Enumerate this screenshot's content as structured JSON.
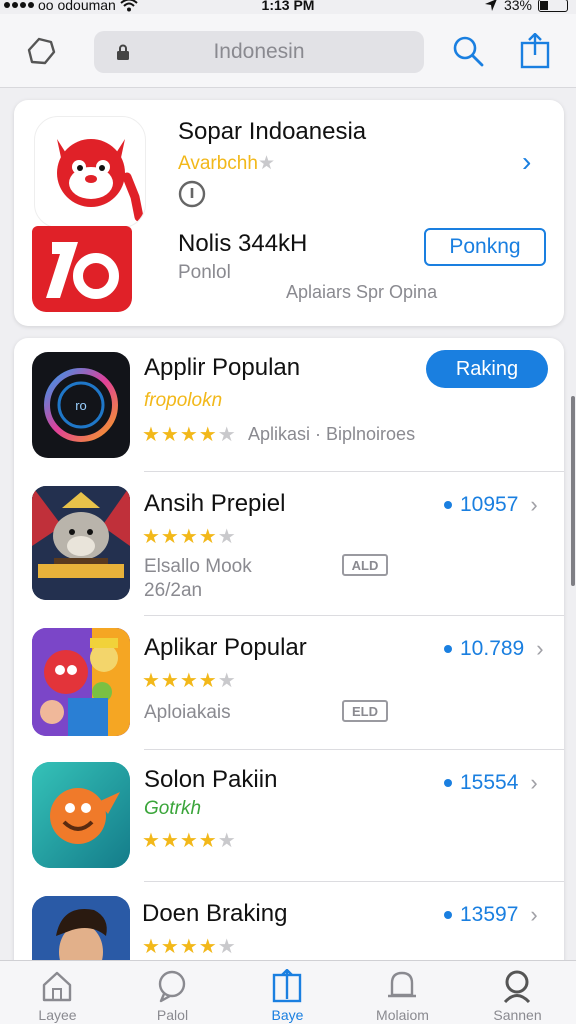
{
  "status_bar": {
    "carrier": "oo odouman",
    "time": "1:13 PM",
    "battery": "33%"
  },
  "nav": {
    "search_text": "Indonesin"
  },
  "featured": {
    "title": "Sopar Indoanesia",
    "subtitle": "Avarbchh",
    "size_text": "Nolis 344kH",
    "category": "Ponlol",
    "caption": "Aplaiars Spr Opina",
    "button_label": "Ponkng"
  },
  "list": {
    "header": {
      "title": "Applir Populan",
      "subtitle": "fropolokn",
      "rating": 4,
      "meta": "Aplikasi · Biplnoiroes",
      "button_label": "Raking"
    },
    "items": [
      {
        "title": "Ansih Prepiel",
        "rating": 4,
        "line1": "Elsallo Mook",
        "line2": "26/2an",
        "badge": "ALD",
        "count": "10957"
      },
      {
        "title": "Aplikar Popular",
        "rating": 4,
        "line1": "Aploiakais",
        "badge": "ELD",
        "count": "10.789"
      },
      {
        "title": "Solon Pakiin",
        "subtitle": "Gotrkh",
        "rating": 4,
        "count": "15554"
      },
      {
        "title": "Doen Braking",
        "rating": 4,
        "count": "13597"
      }
    ]
  },
  "tabs": [
    {
      "label": "Layee",
      "icon": "home-icon"
    },
    {
      "label": "Palol",
      "icon": "chat-icon"
    },
    {
      "label": "Baye",
      "icon": "book-icon"
    },
    {
      "label": "Molaiom",
      "icon": "notification-icon"
    },
    {
      "label": "Sannen",
      "icon": "profile-icon"
    }
  ],
  "colors": {
    "accent": "#1a7fe0",
    "star": "#f2b81a",
    "green_subtitle": "#3aa53a",
    "featured_red": "#e02128"
  }
}
